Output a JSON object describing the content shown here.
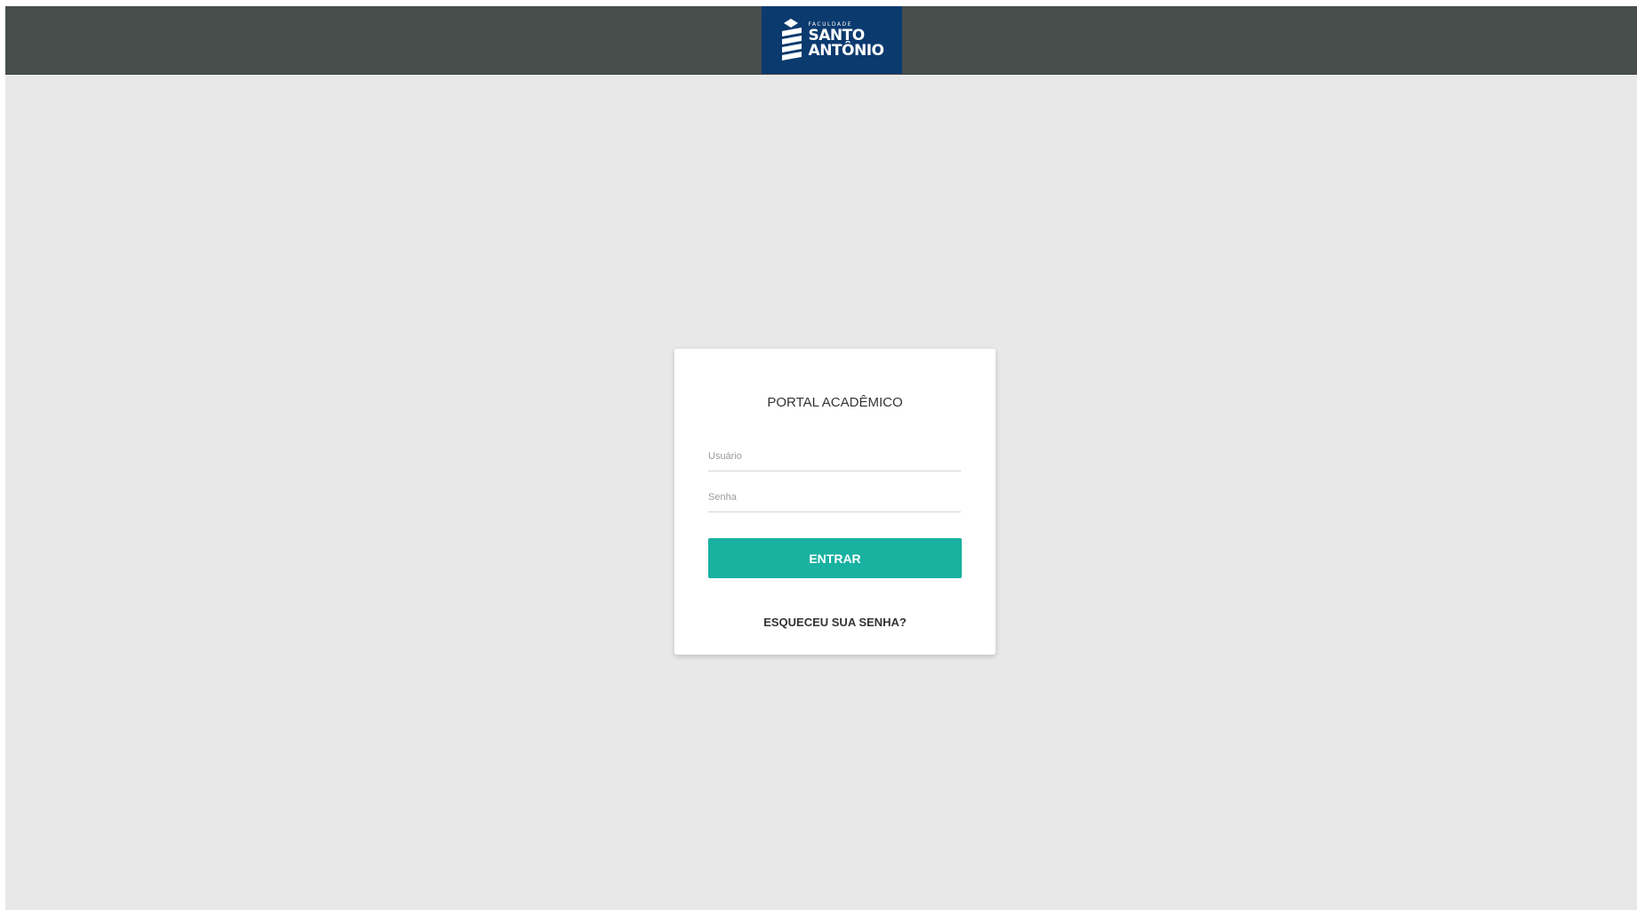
{
  "header": {
    "logo_small": "FACULDADE",
    "logo_line1": "SANTO",
    "logo_line2": "ANTÔNIO",
    "bar_color": "#474d4b",
    "logo_bg": "#0b3a6f"
  },
  "login": {
    "title": "PORTAL ACADÊMICO",
    "username_placeholder": "Usuário",
    "password_placeholder": "Senha",
    "submit_label": "ENTRAR",
    "forgot_label": "ESQUECEU SUA SENHA?",
    "accent_color": "#19b1a0"
  }
}
